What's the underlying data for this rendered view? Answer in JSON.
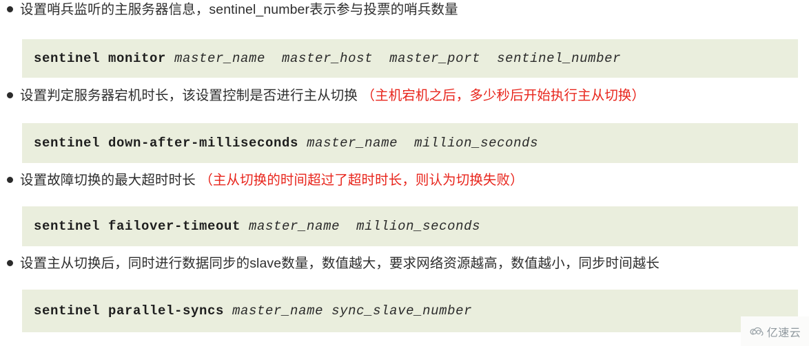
{
  "page": {
    "background_color": "#ffffff",
    "code_block_color": "#eaeedd",
    "red_accent": "#e8251c",
    "text_color": "#2e2e2e"
  },
  "sections": [
    {
      "bullet": {
        "plain_before": "设置哨兵监听的主服务器信息，",
        "code_inline": "sentinel_number",
        "plain_after": "表示参与投票的哨兵数量",
        "red_note": ""
      },
      "code": {
        "command": "sentinel monitor",
        "args": " master_name  master_host  master_port  sentinel_number",
        "full": "sentinel monitor master_name  master_host  master_port  sentinel_number"
      }
    },
    {
      "bullet": {
        "plain_before": "设置判定服务器宕机时长，该设置控制是否进行主从切换 ",
        "code_inline": "",
        "plain_after": "",
        "red_note": "（主机宕机之后，多少秒后开始执行主从切换）"
      },
      "code": {
        "command": "sentinel down-after-milliseconds",
        "args": " master_name  million_seconds",
        "full": "sentinel down-after-milliseconds master_name  million_seconds"
      }
    },
    {
      "bullet": {
        "plain_before": "设置故障切换的最大超时时长 ",
        "code_inline": "",
        "plain_after": "",
        "red_note": "（主从切换的时间超过了超时时长，则认为切换失败）"
      },
      "code": {
        "command": "sentinel failover-timeout",
        "args": " master_name  million_seconds",
        "full": "sentinel failover-timeout master_name  million_seconds"
      }
    },
    {
      "bullet": {
        "plain_before": "设置主从切换后，同时进行数据同步的",
        "code_inline": "slave",
        "plain_after": "数量，数值越大，要求网络资源越高，数值越小，同步时间越长",
        "red_note": ""
      },
      "code": {
        "command": "sentinel parallel-syncs",
        "args": " master_name sync_slave_number",
        "full": "sentinel parallel-syncs master_name sync_slave_number"
      }
    }
  ],
  "watermark": {
    "icon": "cloud-icon",
    "text": "亿速云"
  }
}
